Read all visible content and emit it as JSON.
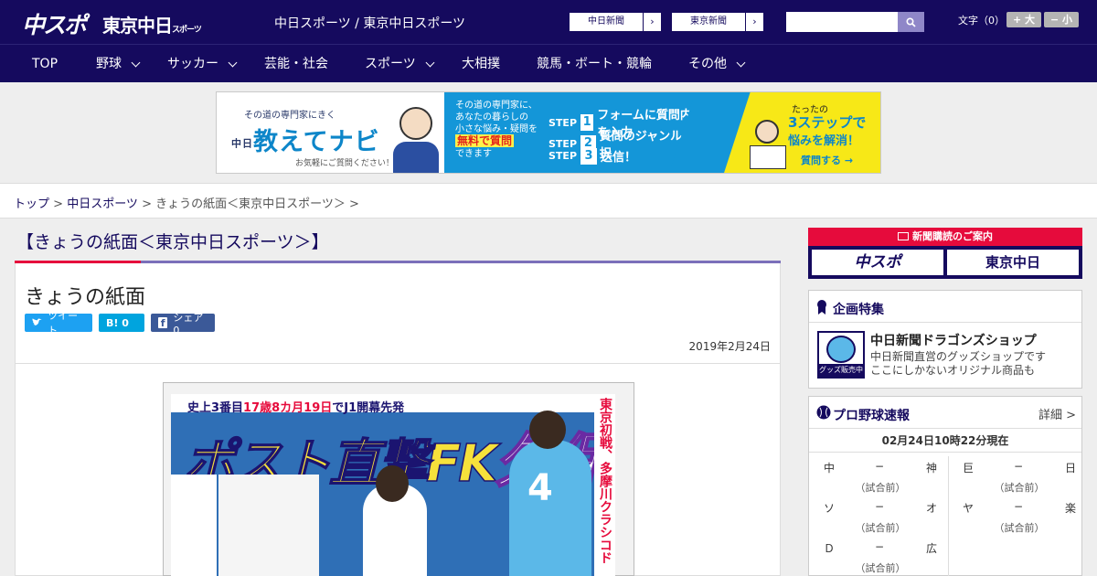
{
  "header": {
    "logo_main": "中スポ",
    "logo_tokyo": "東京中日",
    "logo_tokyo_small": "スポーツ",
    "site_title": "中日スポーツ / 東京中日スポーツ",
    "paper_links": [
      "中日新聞",
      "東京新聞"
    ],
    "search_placeholder": "",
    "font_size_label": "文字（0）",
    "font_larger": "+ 大",
    "font_smaller": "− 小"
  },
  "nav": [
    {
      "label": "TOP",
      "dropdown": false
    },
    {
      "label": "野球",
      "dropdown": true
    },
    {
      "label": "サッカー",
      "dropdown": true
    },
    {
      "label": "芸能・社会",
      "dropdown": false
    },
    {
      "label": "スポーツ",
      "dropdown": true
    },
    {
      "label": "大相撲",
      "dropdown": false
    },
    {
      "label": "競馬・ボート・競輪",
      "dropdown": false
    },
    {
      "label": "その他",
      "dropdown": true
    }
  ],
  "banner": {
    "tagline": "その道の専門家にきく",
    "brand_prefix": "中日",
    "brand": "教えてナビ",
    "note": "お気軽にご質問ください！",
    "q_line1": "その道の専門家に、",
    "q_line2": "あなたの暮らしの",
    "q_line3": "小さな悩み・疑問を",
    "q_highlight": "無料で質問",
    "q_line4": "できます",
    "step_word": "STEP",
    "steps": [
      {
        "num": "1",
        "text": "フォームに質問内容を入力"
      },
      {
        "num": "2",
        "text": "質問のジャンルを選択"
      },
      {
        "num": "3",
        "text": "送信！"
      }
    ],
    "right_line1": "たったの",
    "right_line2": "3ステップで",
    "right_line3": "悩みを解消！",
    "right_cta": "質問する →"
  },
  "breadcrumb": {
    "home": "トップ",
    "sep": " > ",
    "section": "中日スポーツ",
    "current": "きょうの紙面＜東京中日スポーツ＞ >"
  },
  "article": {
    "section_title": "【きょうの紙面＜東京中日スポーツ＞】",
    "title": "きょうの紙面",
    "share_tweet": "ツイート",
    "share_hatena": "B! 0",
    "share_fb": "シェア 0",
    "date": "2019年2月24日"
  },
  "newspaper": {
    "headline_a": "史上3番目",
    "headline_b": "17歳8カ月19日",
    "headline_c": "でJ1開幕先発",
    "big_text": "ポスト直撃FK",
    "big_name": "久保",
    "side_text": "東京初戦、多摩川クラシコド",
    "jersey_no": "4"
  },
  "sidebar": {
    "subscribe_label": "新聞購読のご案内",
    "sub_logo1": "中スポ",
    "sub_logo2": "東京中日",
    "special_title": "企画特集",
    "ds_logo_band": "グッズ販売中",
    "ds_name": "中日新聞ドラゴンズショップ",
    "ds_desc1": "中日新聞直営のグッズショップです",
    "ds_desc2": "ここにしかないオリジナル商品も",
    "score_title": "プロ野球速報",
    "score_more": "詳細 >",
    "score_time": "02月24日10時22分現在",
    "games": [
      {
        "home": "中",
        "dash": "−",
        "away": "神",
        "status": "（試合前）"
      },
      {
        "home": "巨",
        "dash": "−",
        "away": "日",
        "status": "（試合前）"
      },
      {
        "home": "ソ",
        "dash": "−",
        "away": "オ",
        "status": "（試合前）"
      },
      {
        "home": "ヤ",
        "dash": "−",
        "away": "楽",
        "status": "（試合前）"
      },
      {
        "home": "Ｄ",
        "dash": "−",
        "away": "広",
        "status": "（試合前）"
      }
    ]
  },
  "colors": {
    "navy": "#150a5e",
    "red": "#e60b3c",
    "purple_line": "#7b6fba",
    "banner_blue": "#1496d8",
    "banner_yellow": "#f7e817"
  }
}
